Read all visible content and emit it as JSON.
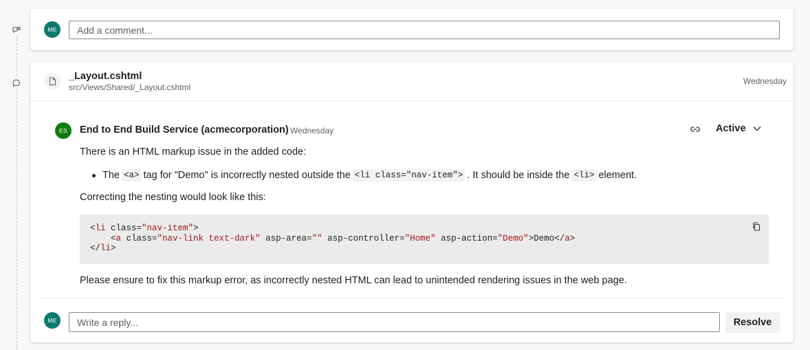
{
  "new_comment": {
    "avatar_initials": "ME",
    "placeholder": "Add a comment..."
  },
  "file": {
    "name": "_Layout.cshtml",
    "path": "src/Views/Shared/_Layout.cshtml",
    "date": "Wednesday"
  },
  "thread": {
    "avatar_initials": "ES",
    "author": "End to End Build Service (acmecorporation)",
    "date": "Wednesday",
    "status": "Active",
    "intro": "There is an HTML markup issue in the added code:",
    "bullet": {
      "t1": "The",
      "c1": "<a>",
      "t2": "tag for \"Demo\" is incorrectly nested outside the",
      "c2": "<li class=\"nav-item\">",
      "t3": ". It should be inside the",
      "c3": "<li>",
      "t4": "element."
    },
    "correction_intro": "Correcting the nesting would look like this:",
    "code": {
      "l1_open": "<",
      "l1_tag": "li",
      "l1_attr": " class=",
      "l1_val": "\"nav-item\"",
      "l1_close": ">",
      "l2_indent": "    <",
      "l2_tag": "a",
      "l2_attr1": " class=",
      "l2_val1": "\"nav-link text-dark\"",
      "l2_attr2": " asp-area=",
      "l2_val2": "\"\"",
      "l2_attr3": " asp-controller=",
      "l2_val3": "\"Home\"",
      "l2_attr4": " asp-action=",
      "l2_val4": "\"Demo\"",
      "l2_text": ">Demo</",
      "l2_endtag": "a",
      "l2_close": ">",
      "l3_open": "</",
      "l3_tag": "li",
      "l3_close": ">"
    },
    "closing": "Please ensure to fix this markup error, as incorrectly nested HTML can lead to unintended rendering issues in the web page."
  },
  "reply": {
    "avatar_initials": "ME",
    "placeholder": "Write a reply...",
    "resolve_label": "Resolve"
  },
  "colors": {
    "avatar_me": "#0c7a6e",
    "avatar_es": "#107c10",
    "code_tag": "#a31515"
  }
}
